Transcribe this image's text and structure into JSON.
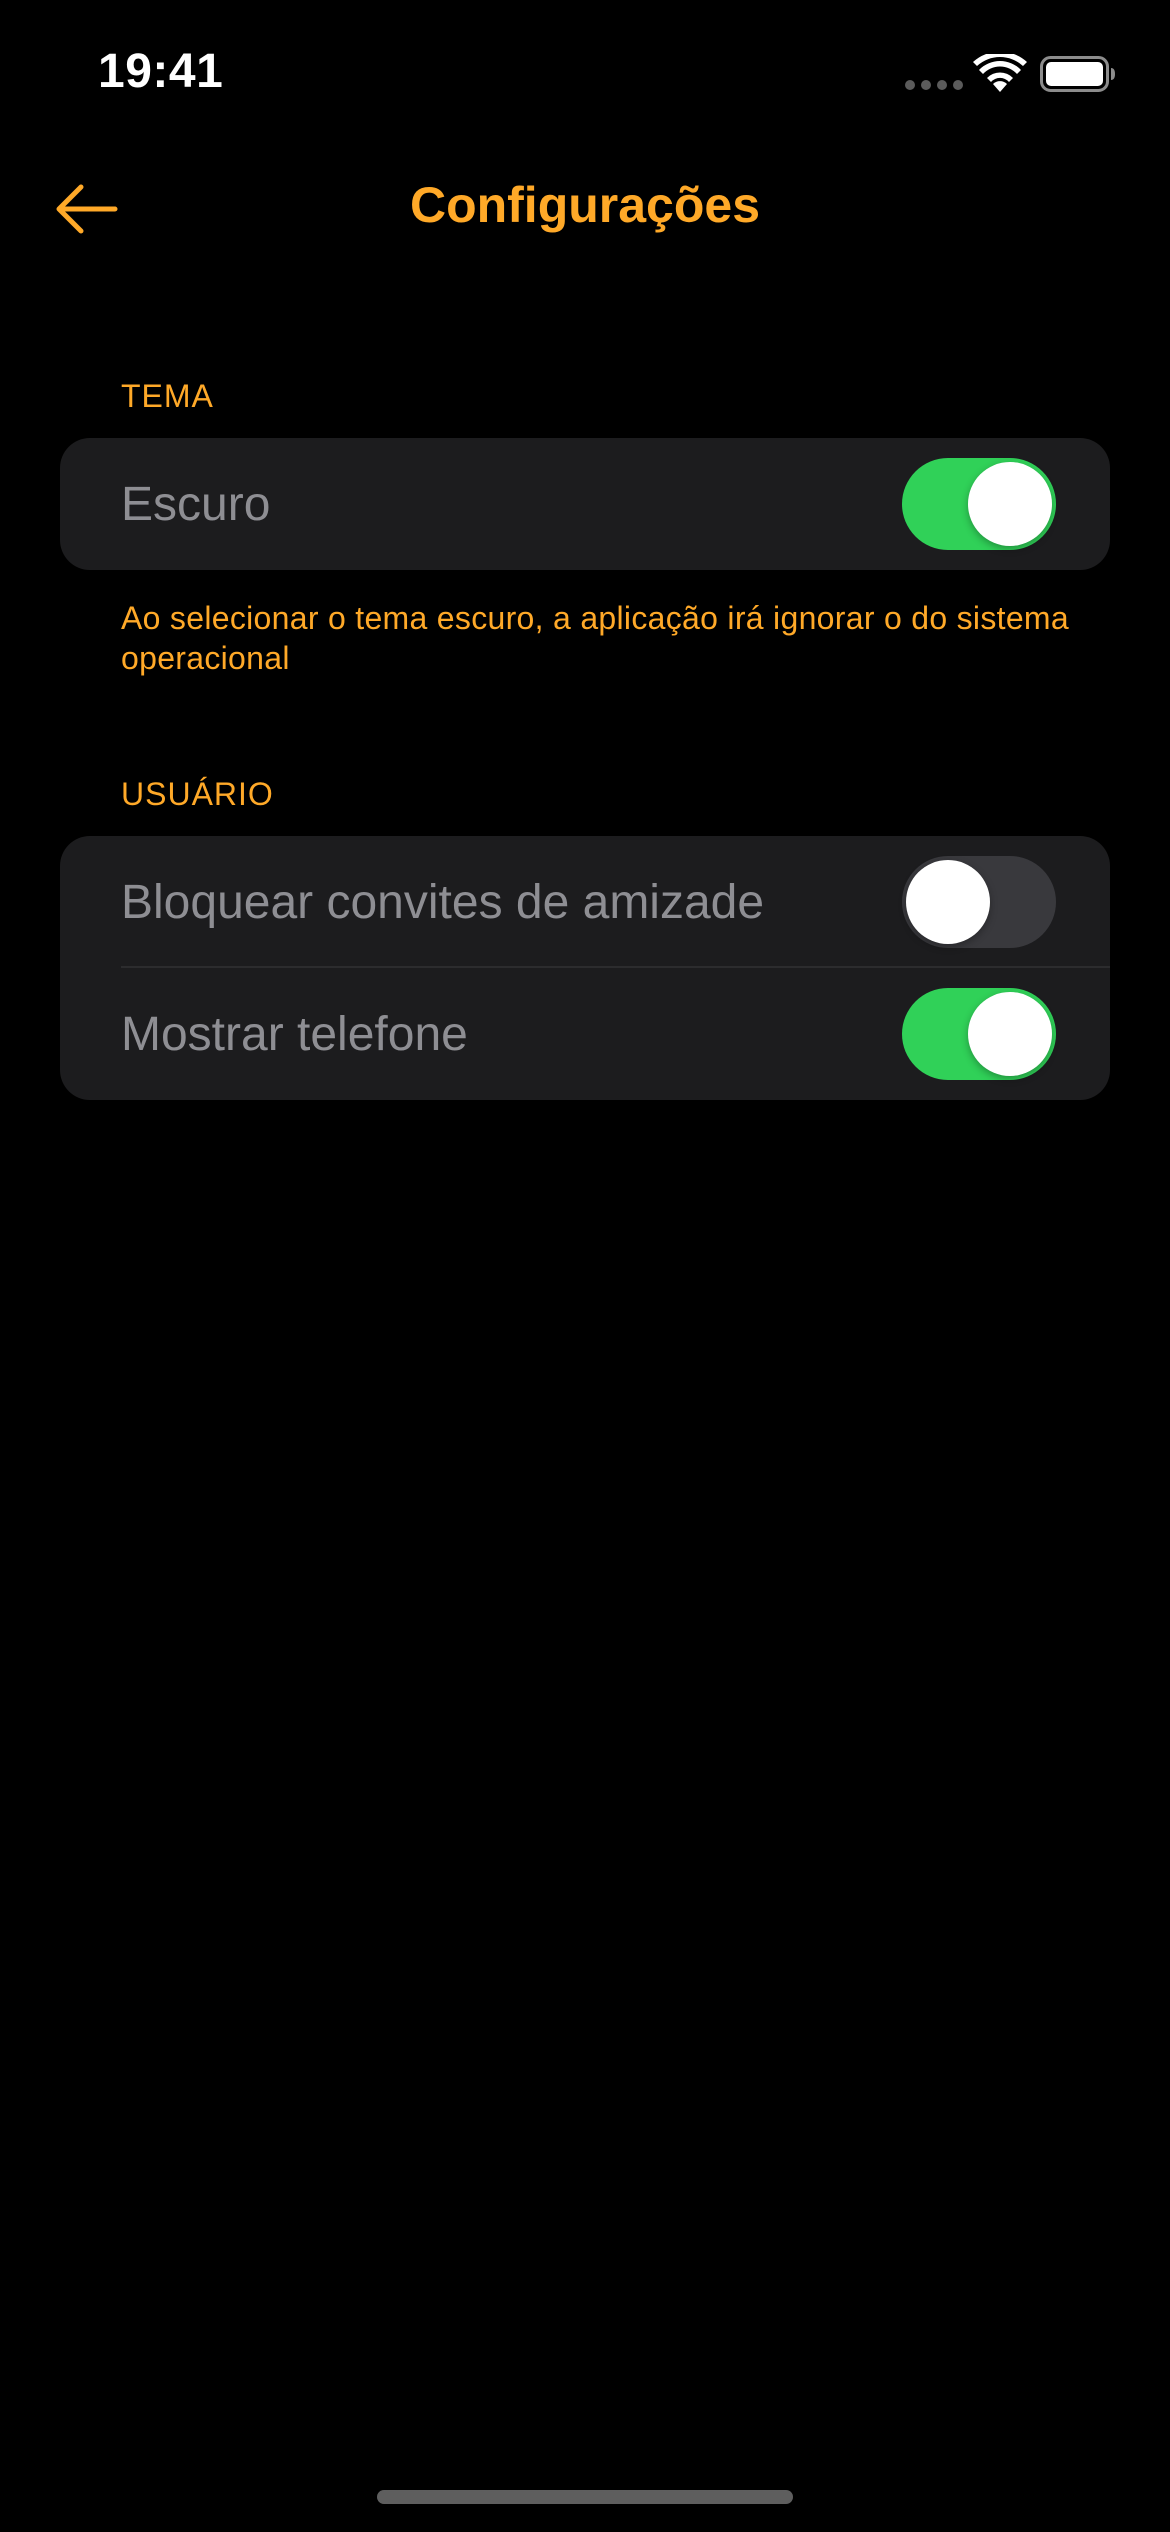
{
  "status_bar": {
    "time": "19:41"
  },
  "header": {
    "title": "Configurações",
    "back_icon": "arrow-left-icon"
  },
  "sections": {
    "theme": {
      "header": "TEMA",
      "items": [
        {
          "label": "Escuro",
          "enabled": true
        }
      ],
      "footer": "Ao selecionar o tema escuro, a aplicação irá ignorar o do sistema operacional"
    },
    "user": {
      "header": "USUÁRIO",
      "items": [
        {
          "label": "Bloquear convites de amizade",
          "enabled": false
        },
        {
          "label": "Mostrar telefone",
          "enabled": true
        }
      ]
    }
  },
  "colors": {
    "accent": "#FFA928",
    "toggle_on": "#30D158",
    "toggle_off": "#39393D",
    "group_background": "#1C1C1E",
    "background": "#000000"
  }
}
